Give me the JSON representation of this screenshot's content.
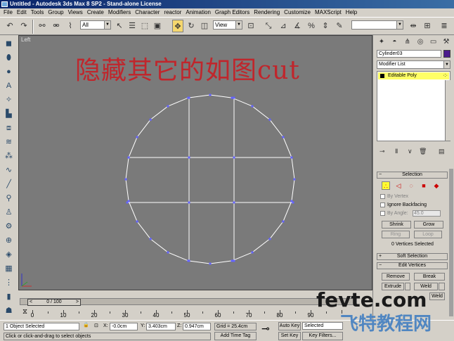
{
  "window": {
    "title": "Untitled - Autodesk 3ds Max 8 SP2 - Stand-alone License"
  },
  "menu": [
    "File",
    "Edit",
    "Tools",
    "Group",
    "Views",
    "Create",
    "Modifiers",
    "Character",
    "reactor",
    "Animation",
    "Graph Editors",
    "Rendering",
    "Customize",
    "MAXScript",
    "Help"
  ],
  "toolbar": {
    "selection_filter": "All",
    "reference_coord": "View"
  },
  "viewport": {
    "label": "Left",
    "overlay_text": "隐藏其它的如图cut"
  },
  "time_slider": {
    "position": "0 / 100",
    "prev": "<",
    "next": ">"
  },
  "trackbar_ticks": [
    "0",
    "10",
    "20",
    "30",
    "40",
    "50",
    "60",
    "70",
    "80",
    "90"
  ],
  "status": {
    "selected": "1 Object Selected",
    "prompt": "Click or click-and-drag to select objects",
    "x_label": "X:",
    "x_value": "-0.0cm",
    "y_label": "Y:",
    "y_value": "3.403cm",
    "z_label": "Z:",
    "z_value": "0.947cm",
    "grid": "Grid = 25.4cm",
    "add_time_tag": "Add Time Tag",
    "auto_key": "Auto Key",
    "set_key": "Set Key",
    "key_mode": "Selected",
    "key_filters": "Key Filters..."
  },
  "command_panel": {
    "object_name": "Cylinder03",
    "object_color": "#4b1a8c",
    "modifier_list": "Modifier List",
    "stack_item": "Editable Poly",
    "selection_rollout": {
      "title": "Selection",
      "by_vertex": "By Vertex",
      "ignore_backfacing": "Ignore Backfacing",
      "by_angle": "By Angle:",
      "angle_value": "45.0",
      "shrink": "Shrink",
      "grow": "Grow",
      "ring": "Ring",
      "loop": "Loop",
      "info": "0 Vertices Selected"
    },
    "soft_selection": "Soft Selection",
    "edit_vertices": {
      "title": "Edit Vertices",
      "remove": "Remove",
      "break": "Break",
      "extrude": "Extrude",
      "weld": "Weld",
      "target_weld": "Weld"
    }
  },
  "watermark": {
    "line1": "fevte.com",
    "line2": "飞特教程网"
  }
}
